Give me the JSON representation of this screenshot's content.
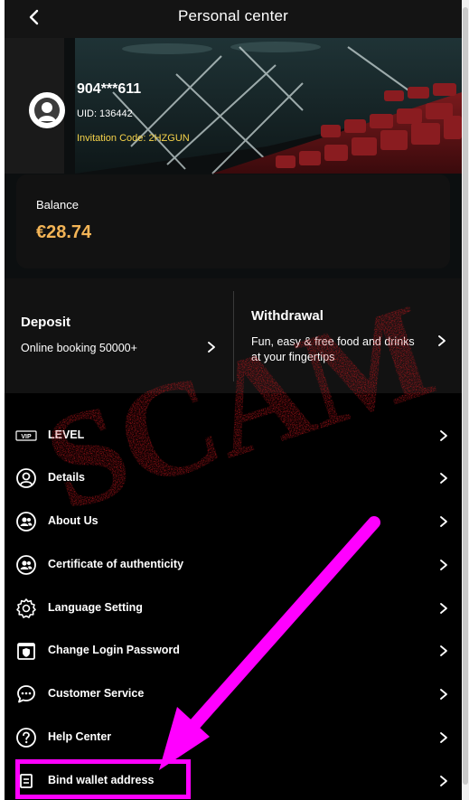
{
  "header": {
    "title": "Personal center",
    "back_icon": "chevron-left-icon"
  },
  "profile": {
    "username": "904***611",
    "uid": "UID: 136442",
    "invitation_code": "Invitation Code: 2HZGUN"
  },
  "balance": {
    "label": "Balance",
    "value": "€28.74"
  },
  "actions": {
    "deposit": {
      "title": "Deposit",
      "description": "Online booking 50000+"
    },
    "withdraw": {
      "title": "Withdrawal",
      "description": "Fun, easy & free food and drinks at your fingertips"
    }
  },
  "menu": {
    "items": [
      {
        "label": "LEVEL",
        "icon": "vip-icon"
      },
      {
        "label": "Details",
        "icon": "user-circle-icon"
      },
      {
        "label": "About Us",
        "icon": "users-icon"
      },
      {
        "label": "Certificate of authenticity",
        "icon": "certificate-icon"
      },
      {
        "label": "Language Setting",
        "icon": "gear-icon"
      },
      {
        "label": "Change Login Password",
        "icon": "shield-icon"
      },
      {
        "label": "Customer Service",
        "icon": "chat-icon"
      },
      {
        "label": "Help Center",
        "icon": "help-icon"
      },
      {
        "label": "Bind wallet address",
        "icon": "wallet-icon"
      }
    ]
  },
  "overlay": {
    "stamp_text": "SCAM",
    "stamp_color": "#c4161c",
    "arrow_color": "#ff00ff"
  },
  "colors": {
    "background": "#000000",
    "card": "#121212",
    "balance_value": "#f3b456",
    "invitation": "#f6d34a"
  }
}
